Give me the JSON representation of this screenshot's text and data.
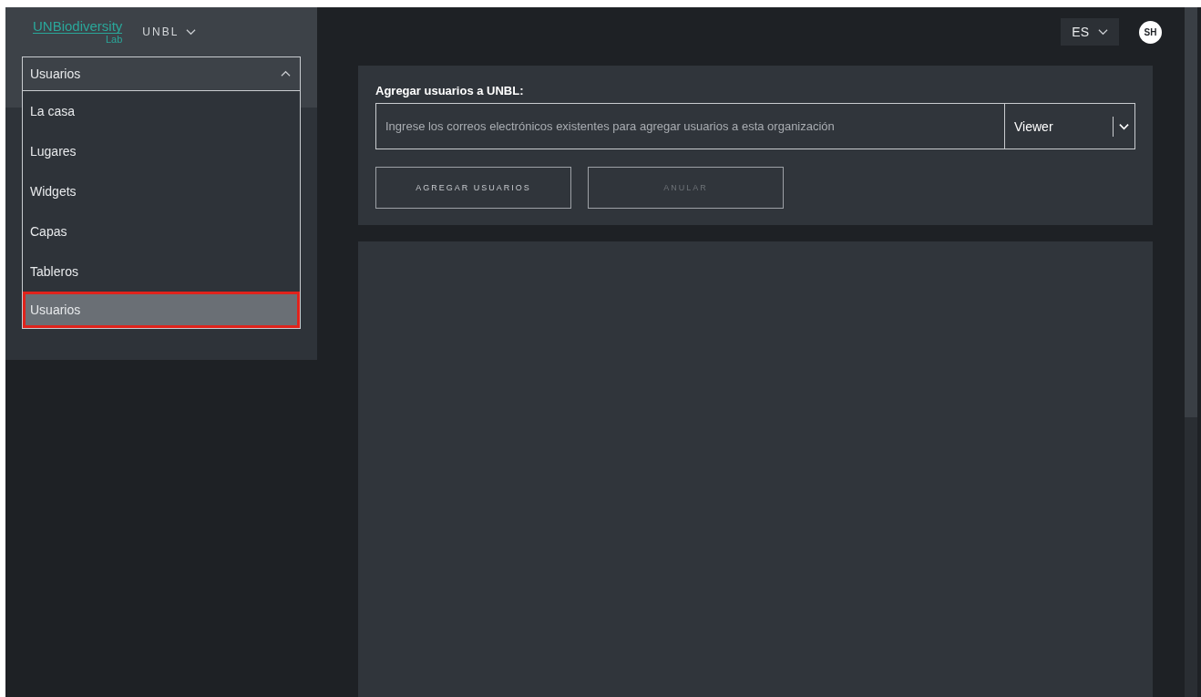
{
  "logo": {
    "title": "UNBiodiversity",
    "subtitle": "Lab"
  },
  "org_switcher": {
    "label": "UNBL"
  },
  "nav_select": {
    "value": "Usuarios",
    "expanded": true,
    "items": [
      {
        "label": "La casa",
        "selected": false
      },
      {
        "label": "Lugares",
        "selected": false
      },
      {
        "label": "Widgets",
        "selected": false
      },
      {
        "label": "Capas",
        "selected": false
      },
      {
        "label": "Tableros",
        "selected": false
      },
      {
        "label": "Usuarios",
        "selected": true
      }
    ]
  },
  "language": {
    "label": "ES"
  },
  "avatar": {
    "initials": "SH"
  },
  "add_users": {
    "title": "Agregar usuarios a UNBL:",
    "email_field": {
      "placeholder": "Ingrese los correos electrónicos existentes para agregar usuarios a esta organización"
    },
    "role": {
      "value": "Viewer"
    },
    "buttons": [
      {
        "label": "AGREGAR USUARIOS",
        "disabled": false
      },
      {
        "label": "ANULAR",
        "disabled": true
      }
    ]
  }
}
